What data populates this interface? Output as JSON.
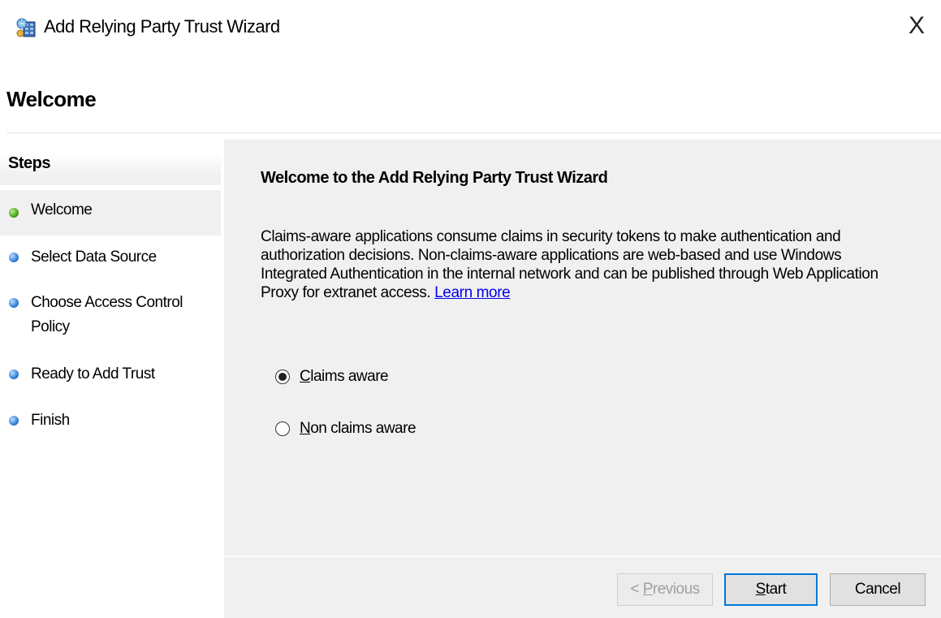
{
  "window": {
    "title": "Add Relying Party Trust Wizard",
    "close_glyph": "X",
    "icon": "relying-party-icon"
  },
  "page": {
    "title": "Welcome"
  },
  "steps": {
    "heading": "Steps",
    "items": [
      {
        "label": "Welcome",
        "status": "current",
        "dot_color": "#4aa321"
      },
      {
        "label": "Select Data Source",
        "status": "pending",
        "dot_color": "#2f7fd8"
      },
      {
        "label": "Choose Access Control Policy",
        "status": "pending",
        "dot_color": "#2f7fd8"
      },
      {
        "label": "Ready to Add Trust",
        "status": "pending",
        "dot_color": "#2f7fd8"
      },
      {
        "label": "Finish",
        "status": "pending",
        "dot_color": "#2f7fd8"
      }
    ]
  },
  "content": {
    "title": "Welcome to the Add Relying Party Trust Wizard",
    "description": "Claims-aware applications consume claims in security tokens to make authentication and authorization decisions. Non-claims-aware applications are web-based and use Windows Integrated Authentication in the internal network and can be published through Web Application Proxy for extranet access.",
    "learn_more": "Learn more",
    "options": [
      {
        "access_key": "C",
        "rest": "laims aware",
        "selected": true
      },
      {
        "access_key": "N",
        "rest": "on claims aware",
        "selected": false
      }
    ]
  },
  "buttons": {
    "previous": {
      "prefix": "< ",
      "access_key": "P",
      "rest": "revious",
      "enabled": false
    },
    "start": {
      "access_key": "S",
      "rest": "tart",
      "enabled": true
    },
    "cancel": {
      "label": "Cancel",
      "enabled": true
    }
  }
}
